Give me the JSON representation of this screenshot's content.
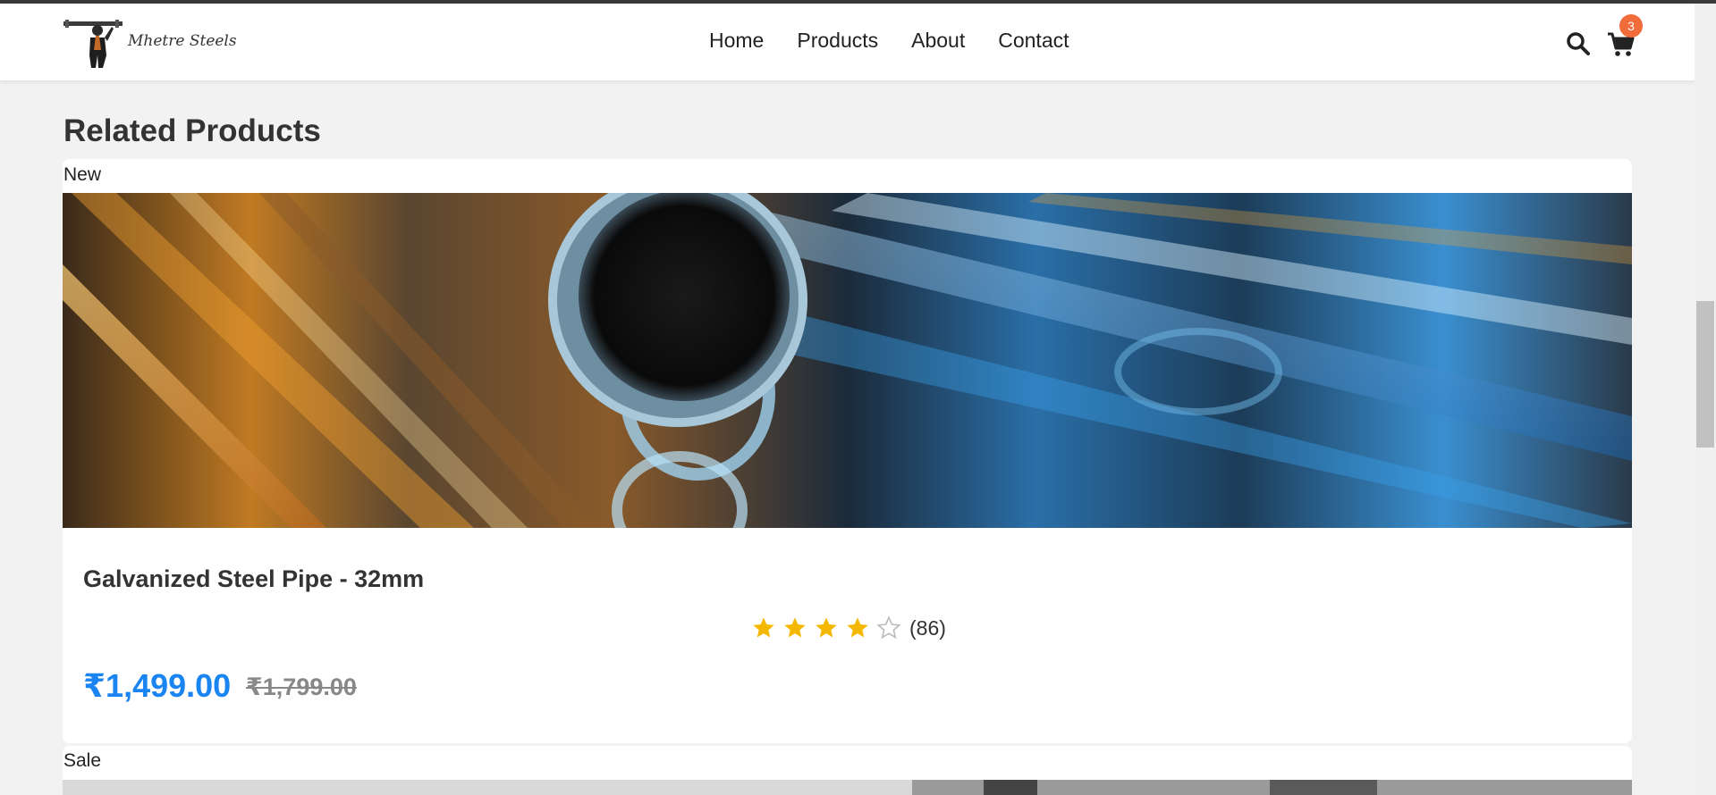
{
  "header": {
    "brand": "Mhetre Steels",
    "nav": [
      {
        "label": "Home"
      },
      {
        "label": "Products"
      },
      {
        "label": "About"
      },
      {
        "label": "Contact"
      }
    ],
    "search_icon": "search-icon",
    "cart_icon": "cart-icon",
    "cart_count": "3"
  },
  "section": {
    "title": "Related Products"
  },
  "products": [
    {
      "tag": "New",
      "name": "Galvanized Steel Pipe - 32mm",
      "rating": 4,
      "rating_max": 5,
      "review_count": "(86)",
      "price": "₹1,499.00",
      "original_price": "₹1,799.00"
    },
    {
      "tag": "Sale"
    }
  ],
  "colors": {
    "accent": "#1a84f2",
    "badge": "#f26b3a",
    "star": "#f5b800",
    "background": "#f2f2f2"
  }
}
